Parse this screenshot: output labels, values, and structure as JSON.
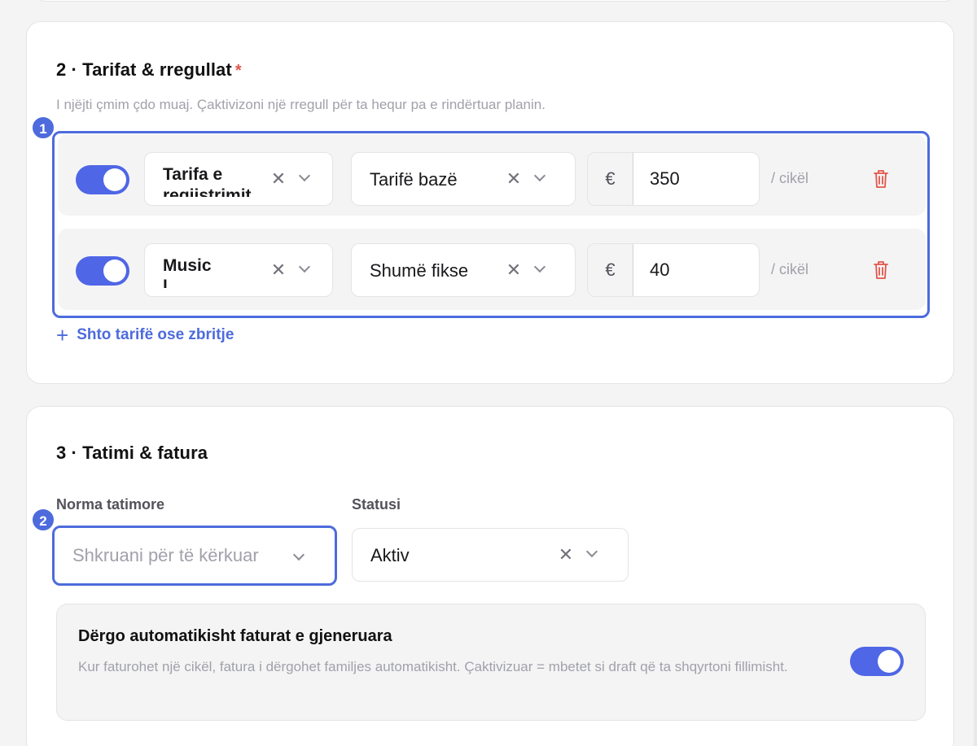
{
  "tarifat": {
    "title": "2 · Tarifat & rregullat",
    "required_mark": "*",
    "subtitle": "I njëjti çmim çdo muaj. Çaktivizoni një rregull për ta hequr pa e rindërtuar planin.",
    "rows": [
      {
        "enabled": true,
        "name": "Tarifa e",
        "name_overflow": "regjistrimit",
        "type": "Tarifë bazë",
        "currency": "€",
        "amount": "350",
        "per": "/ cikël"
      },
      {
        "enabled": true,
        "name": "Music",
        "name_overflow": "l",
        "type": "Shumë fikse",
        "currency": "€",
        "amount": "40",
        "per": "/ cikël"
      }
    ],
    "add_label": "Shto tarifë ose zbritje",
    "add_icon": "plus-icon"
  },
  "tatimi": {
    "title": "3 · Tatimi & fatura",
    "tax_label": "Norma tatimore",
    "tax_placeholder": "Shkruani për të kërkuar",
    "status_label": "Statusi",
    "status_value": "Aktiv",
    "auto_send_title": "Dërgo automatikisht faturat e gjeneruara",
    "auto_send_desc": "Kur faturohet një cikël, fatura i dërgohet familjes automatikisht. Çaktivizuar = mbetet si draft që ta shqyrtoni fillimisht.",
    "auto_send_enabled": true
  },
  "annotations": [
    "1",
    "2"
  ],
  "colors": {
    "accent": "#4d6bdc",
    "toggle": "#4f66e6",
    "danger": "#e2554a"
  }
}
